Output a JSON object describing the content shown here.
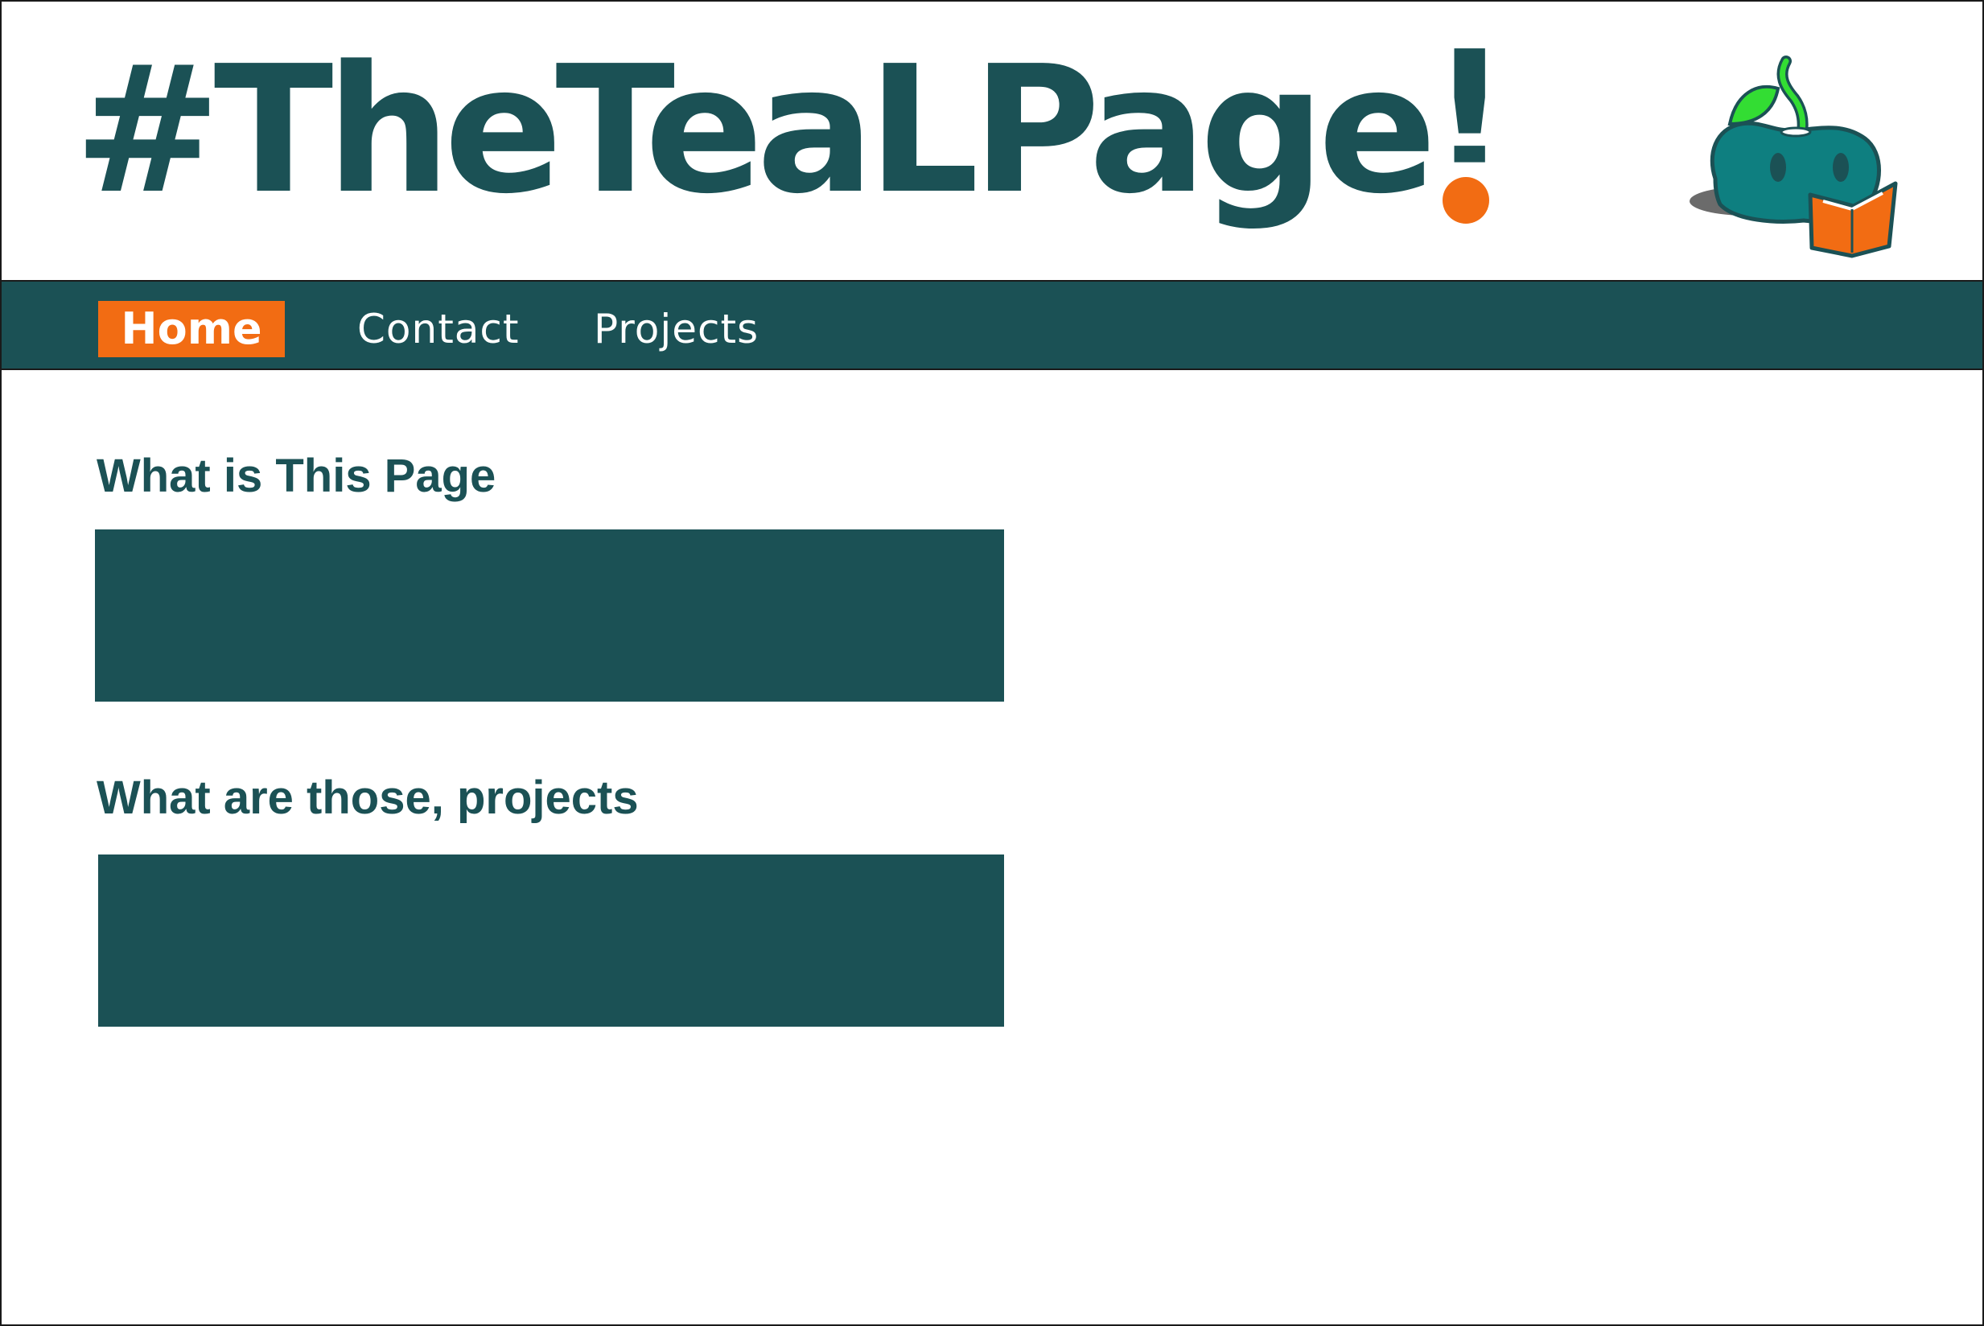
{
  "site": {
    "title_main": "#TheTeaLPage",
    "title_bang": "!",
    "colors": {
      "teal": "#1b5155",
      "orange": "#f26c13",
      "logo_teal": "#0e7f80",
      "leaf_green": "#33dd33"
    },
    "logo_icon": "teal-apple-reading-book"
  },
  "nav": {
    "items": [
      {
        "label": "Home",
        "active": true
      },
      {
        "label": "Contact",
        "active": false
      },
      {
        "label": "Projects",
        "active": false
      }
    ]
  },
  "main": {
    "sections": [
      {
        "heading": "What is This Page"
      },
      {
        "heading": "What are those, projects"
      }
    ]
  }
}
